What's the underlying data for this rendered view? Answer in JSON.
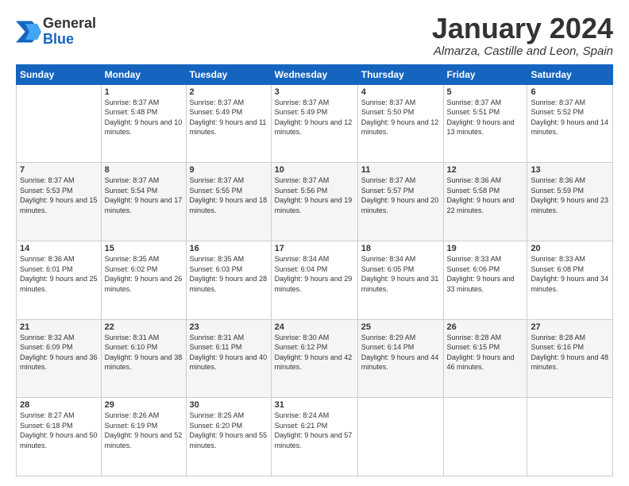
{
  "logo": {
    "line1": "General",
    "line2": "Blue"
  },
  "header": {
    "month": "January 2024",
    "location": "Almarza, Castille and Leon, Spain"
  },
  "weekdays": [
    "Sunday",
    "Monday",
    "Tuesday",
    "Wednesday",
    "Thursday",
    "Friday",
    "Saturday"
  ],
  "weeks": [
    [
      {
        "day": "",
        "sunrise": "",
        "sunset": "",
        "daylight": ""
      },
      {
        "day": "1",
        "sunrise": "Sunrise: 8:37 AM",
        "sunset": "Sunset: 5:48 PM",
        "daylight": "Daylight: 9 hours and 10 minutes."
      },
      {
        "day": "2",
        "sunrise": "Sunrise: 8:37 AM",
        "sunset": "Sunset: 5:49 PM",
        "daylight": "Daylight: 9 hours and 11 minutes."
      },
      {
        "day": "3",
        "sunrise": "Sunrise: 8:37 AM",
        "sunset": "Sunset: 5:49 PM",
        "daylight": "Daylight: 9 hours and 12 minutes."
      },
      {
        "day": "4",
        "sunrise": "Sunrise: 8:37 AM",
        "sunset": "Sunset: 5:50 PM",
        "daylight": "Daylight: 9 hours and 12 minutes."
      },
      {
        "day": "5",
        "sunrise": "Sunrise: 8:37 AM",
        "sunset": "Sunset: 5:51 PM",
        "daylight": "Daylight: 9 hours and 13 minutes."
      },
      {
        "day": "6",
        "sunrise": "Sunrise: 8:37 AM",
        "sunset": "Sunset: 5:52 PM",
        "daylight": "Daylight: 9 hours and 14 minutes."
      }
    ],
    [
      {
        "day": "7",
        "sunrise": "Sunrise: 8:37 AM",
        "sunset": "Sunset: 5:53 PM",
        "daylight": "Daylight: 9 hours and 15 minutes."
      },
      {
        "day": "8",
        "sunrise": "Sunrise: 8:37 AM",
        "sunset": "Sunset: 5:54 PM",
        "daylight": "Daylight: 9 hours and 17 minutes."
      },
      {
        "day": "9",
        "sunrise": "Sunrise: 8:37 AM",
        "sunset": "Sunset: 5:55 PM",
        "daylight": "Daylight: 9 hours and 18 minutes."
      },
      {
        "day": "10",
        "sunrise": "Sunrise: 8:37 AM",
        "sunset": "Sunset: 5:56 PM",
        "daylight": "Daylight: 9 hours and 19 minutes."
      },
      {
        "day": "11",
        "sunrise": "Sunrise: 8:37 AM",
        "sunset": "Sunset: 5:57 PM",
        "daylight": "Daylight: 9 hours and 20 minutes."
      },
      {
        "day": "12",
        "sunrise": "Sunrise: 8:36 AM",
        "sunset": "Sunset: 5:58 PM",
        "daylight": "Daylight: 9 hours and 22 minutes."
      },
      {
        "day": "13",
        "sunrise": "Sunrise: 8:36 AM",
        "sunset": "Sunset: 5:59 PM",
        "daylight": "Daylight: 9 hours and 23 minutes."
      }
    ],
    [
      {
        "day": "14",
        "sunrise": "Sunrise: 8:36 AM",
        "sunset": "Sunset: 6:01 PM",
        "daylight": "Daylight: 9 hours and 25 minutes."
      },
      {
        "day": "15",
        "sunrise": "Sunrise: 8:35 AM",
        "sunset": "Sunset: 6:02 PM",
        "daylight": "Daylight: 9 hours and 26 minutes."
      },
      {
        "day": "16",
        "sunrise": "Sunrise: 8:35 AM",
        "sunset": "Sunset: 6:03 PM",
        "daylight": "Daylight: 9 hours and 28 minutes."
      },
      {
        "day": "17",
        "sunrise": "Sunrise: 8:34 AM",
        "sunset": "Sunset: 6:04 PM",
        "daylight": "Daylight: 9 hours and 29 minutes."
      },
      {
        "day": "18",
        "sunrise": "Sunrise: 8:34 AM",
        "sunset": "Sunset: 6:05 PM",
        "daylight": "Daylight: 9 hours and 31 minutes."
      },
      {
        "day": "19",
        "sunrise": "Sunrise: 8:33 AM",
        "sunset": "Sunset: 6:06 PM",
        "daylight": "Daylight: 9 hours and 33 minutes."
      },
      {
        "day": "20",
        "sunrise": "Sunrise: 8:33 AM",
        "sunset": "Sunset: 6:08 PM",
        "daylight": "Daylight: 9 hours and 34 minutes."
      }
    ],
    [
      {
        "day": "21",
        "sunrise": "Sunrise: 8:32 AM",
        "sunset": "Sunset: 6:09 PM",
        "daylight": "Daylight: 9 hours and 36 minutes."
      },
      {
        "day": "22",
        "sunrise": "Sunrise: 8:31 AM",
        "sunset": "Sunset: 6:10 PM",
        "daylight": "Daylight: 9 hours and 38 minutes."
      },
      {
        "day": "23",
        "sunrise": "Sunrise: 8:31 AM",
        "sunset": "Sunset: 6:11 PM",
        "daylight": "Daylight: 9 hours and 40 minutes."
      },
      {
        "day": "24",
        "sunrise": "Sunrise: 8:30 AM",
        "sunset": "Sunset: 6:12 PM",
        "daylight": "Daylight: 9 hours and 42 minutes."
      },
      {
        "day": "25",
        "sunrise": "Sunrise: 8:29 AM",
        "sunset": "Sunset: 6:14 PM",
        "daylight": "Daylight: 9 hours and 44 minutes."
      },
      {
        "day": "26",
        "sunrise": "Sunrise: 8:28 AM",
        "sunset": "Sunset: 6:15 PM",
        "daylight": "Daylight: 9 hours and 46 minutes."
      },
      {
        "day": "27",
        "sunrise": "Sunrise: 8:28 AM",
        "sunset": "Sunset: 6:16 PM",
        "daylight": "Daylight: 9 hours and 48 minutes."
      }
    ],
    [
      {
        "day": "28",
        "sunrise": "Sunrise: 8:27 AM",
        "sunset": "Sunset: 6:18 PM",
        "daylight": "Daylight: 9 hours and 50 minutes."
      },
      {
        "day": "29",
        "sunrise": "Sunrise: 8:26 AM",
        "sunset": "Sunset: 6:19 PM",
        "daylight": "Daylight: 9 hours and 52 minutes."
      },
      {
        "day": "30",
        "sunrise": "Sunrise: 8:25 AM",
        "sunset": "Sunset: 6:20 PM",
        "daylight": "Daylight: 9 hours and 55 minutes."
      },
      {
        "day": "31",
        "sunrise": "Sunrise: 8:24 AM",
        "sunset": "Sunset: 6:21 PM",
        "daylight": "Daylight: 9 hours and 57 minutes."
      },
      {
        "day": "",
        "sunrise": "",
        "sunset": "",
        "daylight": ""
      },
      {
        "day": "",
        "sunrise": "",
        "sunset": "",
        "daylight": ""
      },
      {
        "day": "",
        "sunrise": "",
        "sunset": "",
        "daylight": ""
      }
    ]
  ]
}
